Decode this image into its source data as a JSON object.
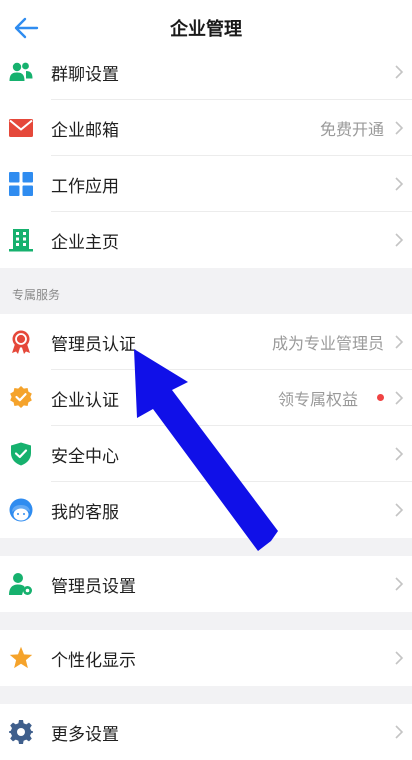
{
  "header": {
    "title": "企业管理",
    "back_icon": "back-arrow-icon"
  },
  "menu_group_1": [
    {
      "label": "群聊设置",
      "value": "",
      "icon": "group-chat-icon",
      "color": "#16b16e"
    },
    {
      "label": "企业邮箱",
      "value": "免费开通",
      "icon": "mail-icon",
      "color": "#e5483a"
    },
    {
      "label": "工作应用",
      "value": "",
      "icon": "apps-grid-icon",
      "color": "#2f8cf0"
    },
    {
      "label": "企业主页",
      "value": "",
      "icon": "building-icon",
      "color": "#16b16e"
    }
  ],
  "section": {
    "title": "专属服务"
  },
  "menu_group_2": [
    {
      "label": "管理员认证",
      "value": "成为专业管理员",
      "icon": "ribbon-medal-icon",
      "color": "#e5483a"
    },
    {
      "label": "企业认证",
      "value": "领专属权益",
      "icon": "verified-badge-icon",
      "color": "#f5a32b",
      "has_dot": true
    },
    {
      "label": "安全中心",
      "value": "",
      "icon": "shield-check-icon",
      "color": "#16b16e"
    },
    {
      "label": "我的客服",
      "value": "",
      "icon": "customer-service-icon",
      "color": "#2f8cf0"
    }
  ],
  "menu_group_3": [
    {
      "label": "管理员设置",
      "value": "",
      "icon": "admin-settings-icon",
      "color": "#16b16e"
    }
  ],
  "menu_group_4": [
    {
      "label": "个性化显示",
      "value": "",
      "icon": "star-icon",
      "color": "#f5a32b"
    }
  ],
  "menu_group_5": [
    {
      "label": "更多设置",
      "value": "",
      "icon": "gear-icon",
      "color": "#3f5f8c"
    }
  ],
  "colors": {
    "accent_blue": "#2f8cf0",
    "annotation_arrow": "#1010e8",
    "red_dot": "#f04343"
  }
}
